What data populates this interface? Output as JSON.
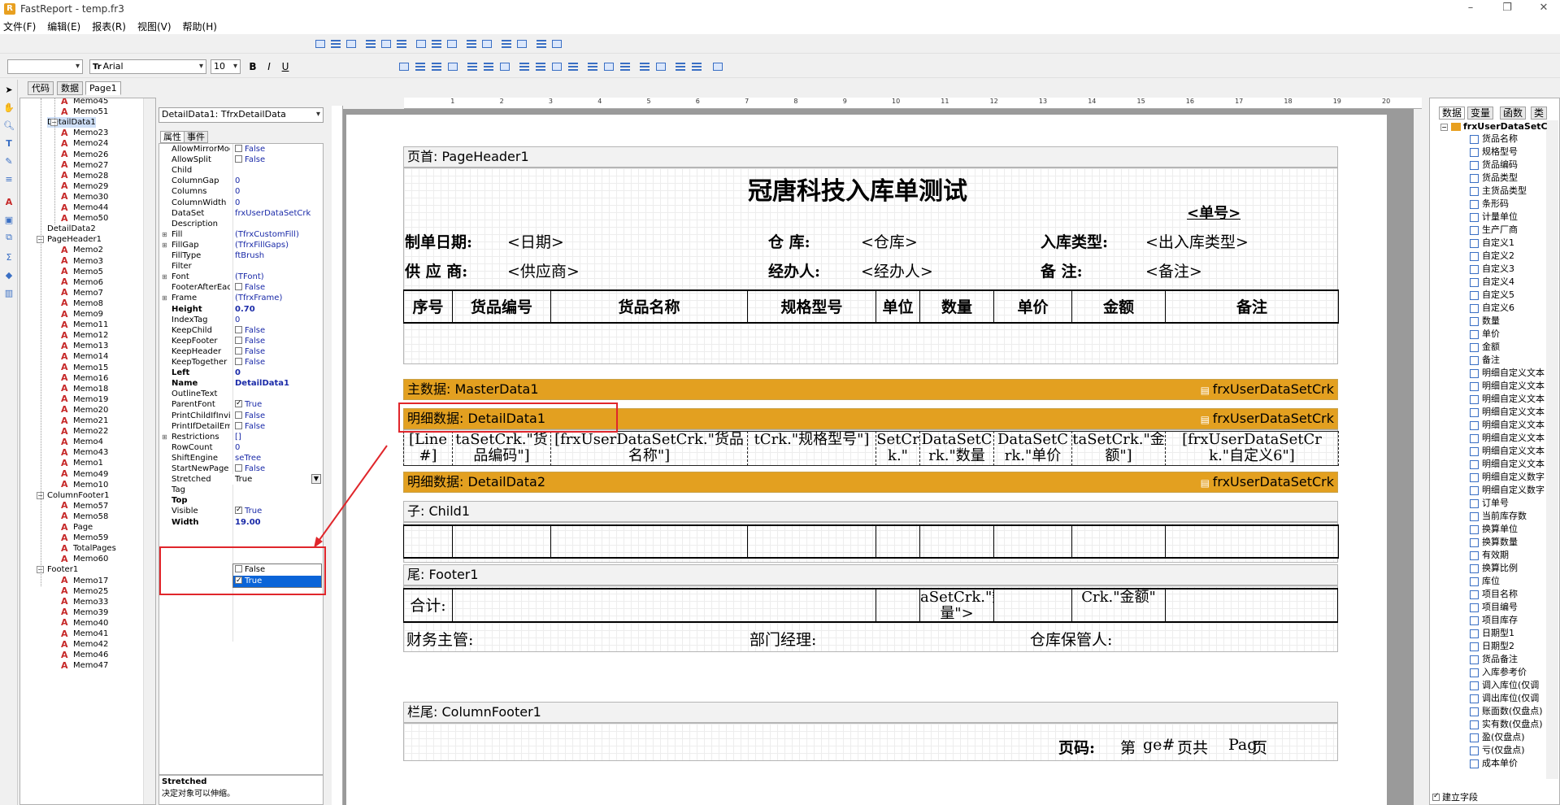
{
  "window": {
    "title": "FastReport - temp.fr3",
    "logo": "R"
  },
  "menu": [
    "文件(F)",
    "编辑(E)",
    "报表(R)",
    "视图(V)",
    "帮助(H)"
  ],
  "toolbar": {
    "style_combo": "",
    "font": "Arial",
    "font_prefix": "Tr",
    "size": "10",
    "bold": "B",
    "italic": "I",
    "underline": "U"
  },
  "tabs": [
    "代码",
    "数据",
    "Page1"
  ],
  "tree": [
    {
      "label": "Memo45",
      "level": 3,
      "kind": "memo"
    },
    {
      "label": "Memo51",
      "level": 3,
      "kind": "memo"
    },
    {
      "label": "DetailData1",
      "level": 2,
      "kind": "band",
      "expanded": true,
      "selected": true
    },
    {
      "label": "Memo23",
      "level": 3,
      "kind": "memo"
    },
    {
      "label": "Memo24",
      "level": 3,
      "kind": "memo"
    },
    {
      "label": "Memo26",
      "level": 3,
      "kind": "memo"
    },
    {
      "label": "Memo27",
      "level": 3,
      "kind": "memo"
    },
    {
      "label": "Memo28",
      "level": 3,
      "kind": "memo"
    },
    {
      "label": "Memo29",
      "level": 3,
      "kind": "memo"
    },
    {
      "label": "Memo30",
      "level": 3,
      "kind": "memo"
    },
    {
      "label": "Memo44",
      "level": 3,
      "kind": "memo"
    },
    {
      "label": "Memo50",
      "level": 3,
      "kind": "memo"
    },
    {
      "label": "DetailData2",
      "level": 2,
      "kind": "band"
    },
    {
      "label": "PageHeader1",
      "level": 1,
      "kind": "band",
      "expanded": true
    },
    {
      "label": "Memo2",
      "level": 3,
      "kind": "memo"
    },
    {
      "label": "Memo3",
      "level": 3,
      "kind": "memo"
    },
    {
      "label": "Memo5",
      "level": 3,
      "kind": "memo"
    },
    {
      "label": "Memo6",
      "level": 3,
      "kind": "memo"
    },
    {
      "label": "Memo7",
      "level": 3,
      "kind": "memo"
    },
    {
      "label": "Memo8",
      "level": 3,
      "kind": "memo"
    },
    {
      "label": "Memo9",
      "level": 3,
      "kind": "memo"
    },
    {
      "label": "Memo11",
      "level": 3,
      "kind": "memo"
    },
    {
      "label": "Memo12",
      "level": 3,
      "kind": "memo"
    },
    {
      "label": "Memo13",
      "level": 3,
      "kind": "memo"
    },
    {
      "label": "Memo14",
      "level": 3,
      "kind": "memo"
    },
    {
      "label": "Memo15",
      "level": 3,
      "kind": "memo"
    },
    {
      "label": "Memo16",
      "level": 3,
      "kind": "memo"
    },
    {
      "label": "Memo18",
      "level": 3,
      "kind": "memo"
    },
    {
      "label": "Memo19",
      "level": 3,
      "kind": "memo"
    },
    {
      "label": "Memo20",
      "level": 3,
      "kind": "memo"
    },
    {
      "label": "Memo21",
      "level": 3,
      "kind": "memo"
    },
    {
      "label": "Memo22",
      "level": 3,
      "kind": "memo"
    },
    {
      "label": "Memo4",
      "level": 3,
      "kind": "memo"
    },
    {
      "label": "Memo43",
      "level": 3,
      "kind": "memo"
    },
    {
      "label": "Memo1",
      "level": 3,
      "kind": "memo"
    },
    {
      "label": "Memo49",
      "level": 3,
      "kind": "memo"
    },
    {
      "label": "Memo10",
      "level": 3,
      "kind": "memo"
    },
    {
      "label": "ColumnFooter1",
      "level": 1,
      "kind": "band",
      "expanded": true
    },
    {
      "label": "Memo57",
      "level": 3,
      "kind": "memo"
    },
    {
      "label": "Memo58",
      "level": 3,
      "kind": "memo"
    },
    {
      "label": "Page",
      "level": 3,
      "kind": "memo"
    },
    {
      "label": "Memo59",
      "level": 3,
      "kind": "memo"
    },
    {
      "label": "TotalPages",
      "level": 3,
      "kind": "memo"
    },
    {
      "label": "Memo60",
      "level": 3,
      "kind": "memo"
    },
    {
      "label": "Footer1",
      "level": 1,
      "kind": "band",
      "expanded": true
    },
    {
      "label": "Memo17",
      "level": 3,
      "kind": "memo"
    },
    {
      "label": "Memo25",
      "level": 3,
      "kind": "memo"
    },
    {
      "label": "Memo33",
      "level": 3,
      "kind": "memo"
    },
    {
      "label": "Memo39",
      "level": 3,
      "kind": "memo"
    },
    {
      "label": "Memo40",
      "level": 3,
      "kind": "memo"
    },
    {
      "label": "Memo41",
      "level": 3,
      "kind": "memo"
    },
    {
      "label": "Memo42",
      "level": 3,
      "kind": "memo"
    },
    {
      "label": "Memo46",
      "level": 3,
      "kind": "memo"
    },
    {
      "label": "Memo47",
      "level": 3,
      "kind": "memo"
    }
  ],
  "inspector": {
    "object": "DetailData1: TfrxDetailData",
    "tabs": [
      "属性",
      "事件"
    ],
    "props": [
      {
        "n": "AllowMirrorMode",
        "v": "False",
        "cb": "off"
      },
      {
        "n": "AllowSplit",
        "v": "False",
        "cb": "off"
      },
      {
        "n": "Child",
        "v": ""
      },
      {
        "n": "ColumnGap",
        "v": "0"
      },
      {
        "n": "Columns",
        "v": "0"
      },
      {
        "n": "ColumnWidth",
        "v": "0"
      },
      {
        "n": "DataSet",
        "v": "frxUserDataSetCrk"
      },
      {
        "n": "Description",
        "v": ""
      },
      {
        "n": "Fill",
        "v": "(TfrxCustomFill)",
        "exp": true
      },
      {
        "n": "FillGap",
        "v": "(TfrxFillGaps)",
        "exp": true
      },
      {
        "n": "FillType",
        "v": "ftBrush"
      },
      {
        "n": "Filter",
        "v": ""
      },
      {
        "n": "Font",
        "v": "(TFont)",
        "exp": true
      },
      {
        "n": "FooterAfterEach",
        "v": "False",
        "cb": "off"
      },
      {
        "n": "Frame",
        "v": "(TfrxFrame)",
        "exp": true
      },
      {
        "n": "Height",
        "v": "0.70",
        "bold": true
      },
      {
        "n": "IndexTag",
        "v": "0"
      },
      {
        "n": "KeepChild",
        "v": "False",
        "cb": "off"
      },
      {
        "n": "KeepFooter",
        "v": "False",
        "cb": "off"
      },
      {
        "n": "KeepHeader",
        "v": "False",
        "cb": "off"
      },
      {
        "n": "KeepTogether",
        "v": "False",
        "cb": "off"
      },
      {
        "n": "Left",
        "v": "0",
        "bold": true
      },
      {
        "n": "Name",
        "v": "DetailData1",
        "bold": true
      },
      {
        "n": "OutlineText",
        "v": ""
      },
      {
        "n": "ParentFont",
        "v": "True",
        "cb": "on"
      },
      {
        "n": "PrintChildIfInvisible",
        "v": "False",
        "cb": "off"
      },
      {
        "n": "PrintIfDetailEmpty",
        "v": "False",
        "cb": "off"
      },
      {
        "n": "Restrictions",
        "v": "[]",
        "exp": true
      },
      {
        "n": "RowCount",
        "v": "0"
      },
      {
        "n": "ShiftEngine",
        "v": "seTree"
      },
      {
        "n": "StartNewPage",
        "v": "False",
        "cb": "off"
      },
      {
        "n": "Stretched",
        "v": "True"
      },
      {
        "n": "Tag",
        "v": ""
      },
      {
        "n": "Top",
        "v": "",
        "bold": true
      },
      {
        "n": "Visible",
        "v": "True",
        "cb": "on"
      },
      {
        "n": "Width",
        "v": "19.00",
        "bold": true
      }
    ],
    "dropdown": [
      "False",
      "True"
    ],
    "hint_title": "Stretched",
    "hint_text": "决定对象可以伸缩。"
  },
  "ruler_marks": [
    "1",
    "2",
    "3",
    "4",
    "5",
    "6",
    "7",
    "8",
    "9",
    "10",
    "11",
    "12",
    "13",
    "14",
    "15",
    "16",
    "17",
    "18",
    "19",
    "20"
  ],
  "report": {
    "page_header": "页首: PageHeader1",
    "title": "冠唐科技入库单测试",
    "order_no": "<单号>",
    "row1": [
      {
        "l": "制单日期:",
        "v": "<日期>"
      },
      {
        "l": "仓    库:",
        "v": "<仓库>"
      },
      {
        "l": "入库类型:",
        "v": "<出入库类型>"
      }
    ],
    "row2": [
      {
        "l": "供 应 商:",
        "v": "<供应商>"
      },
      {
        "l": "经办人:",
        "v": "<经办人>"
      },
      {
        "l": "备    注:",
        "v": "<备注>"
      }
    ],
    "columns": [
      "序号",
      "货品编号",
      "货品名称",
      "规格型号",
      "单位",
      "数量",
      "单价",
      "金额",
      "备注"
    ],
    "master": "主数据: MasterData1",
    "master_ds": "frxUserDataSetCrk",
    "detail1": "明细数据: DetailData1",
    "detail1_ds": "frxUserDataSetCrk",
    "detail1_cells": [
      "[Line#]",
      "taSetCrk.\"货品编码\"]",
      "[frxUserDataSetCrk.\"货品名称\"]",
      "tCrk.\"规格型号\"]",
      "SetCrk.\"",
      "DataSetCrk.\"数量",
      "DataSetCrk.\"单价",
      "taSetCrk.\"金额\"]",
      "[frxUserDataSetCrk.\"自定义6\"]"
    ],
    "detail2": "明细数据: DetailData2",
    "detail2_ds": "frxUserDataSetCrk",
    "child": "子: Child1",
    "footer": "尾: Footer1",
    "total_label": "合计:",
    "total_qty": "aSetCrk.\"数量\">",
    "total_amt": "Crk.\"金额\"",
    "signs": [
      "财务主管:",
      "部门经理:",
      "仓库保管人:"
    ],
    "col_footer": "栏尾: ColumnFooter1",
    "page_no": [
      "页码:",
      "第",
      "ge#",
      "页共",
      "Pag",
      "页"
    ]
  },
  "right_tabs": [
    "数据",
    "变量",
    "函数",
    "类"
  ],
  "right_root": "frxUserDataSetC",
  "fields": [
    "货品名称",
    "规格型号",
    "货品编码",
    "货品类型",
    "主货品类型",
    "条形码",
    "计量单位",
    "生产厂商",
    "自定义1",
    "自定义2",
    "自定义3",
    "自定义4",
    "自定义5",
    "自定义6",
    "数量",
    "单价",
    "金额",
    "备注",
    "明细自定义文本",
    "明细自定义文本",
    "明细自定义文本",
    "明细自定义文本",
    "明细自定义文本",
    "明细自定义文本",
    "明细自定义文本",
    "明细自定义文本",
    "明细自定义数字",
    "明细自定义数字",
    "订单号",
    "当前库存数",
    "换算单位",
    "换算数量",
    "有效期",
    "换算比例",
    "库位",
    "项目名称",
    "项目编号",
    "项目库存",
    "日期型1",
    "日期型2",
    "货品备注",
    "入库参考价",
    "调入库位(仅调",
    "调出库位(仅调",
    "账面数(仅盘点)",
    "实有数(仅盘点)",
    "盈(仅盘点)",
    "亏(仅盘点)",
    "成本单价"
  ],
  "build_fields": "建立字段",
  "colors": {
    "band": "#e3a020",
    "highlight": "#e0262b",
    "select": "#0a64d8"
  }
}
